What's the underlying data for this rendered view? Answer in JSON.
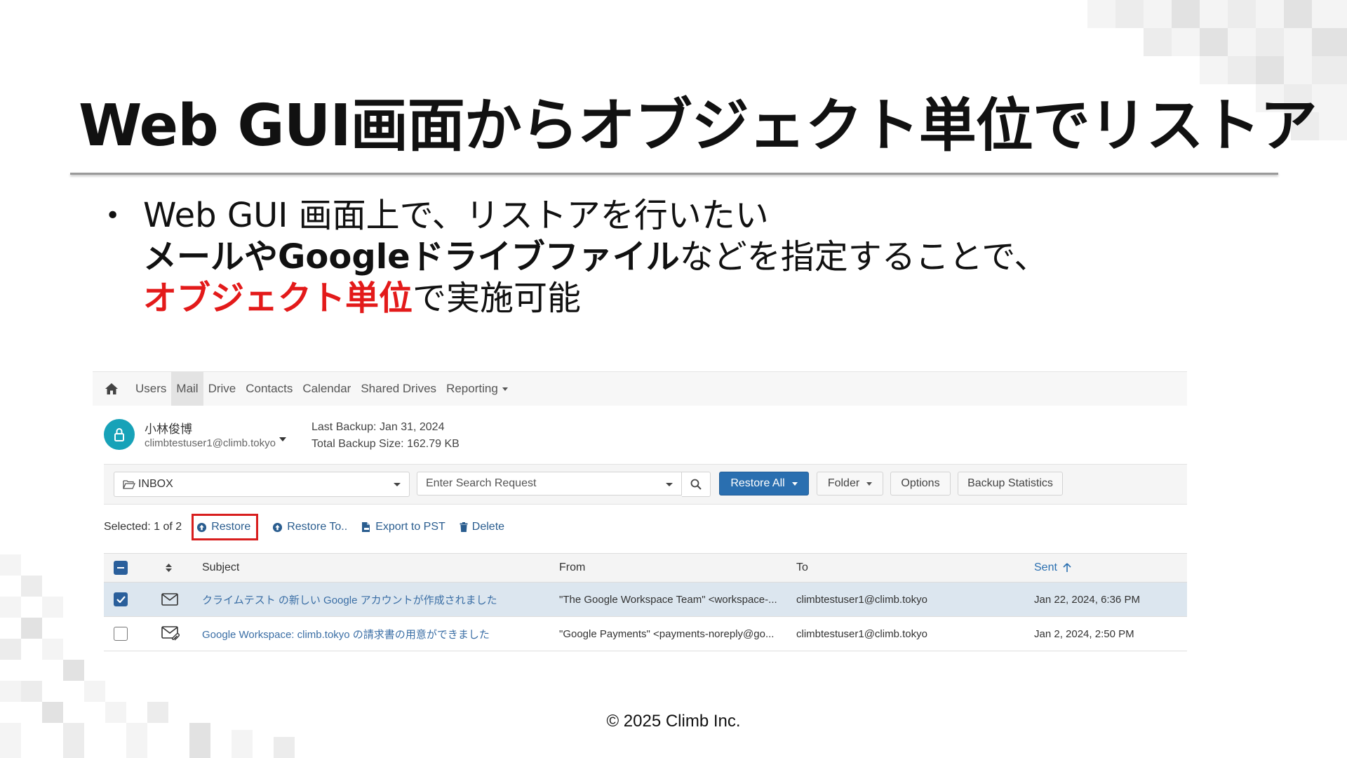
{
  "slide": {
    "title": "Web GUI画面からオブジェクト単位でリストア",
    "bullet_line1": "Web GUI 画面上で、リストアを行いたい",
    "bullet_line2_bold": "メールやGoogleドライブファイル",
    "bullet_line2_rest": "などを指定することで、",
    "bullet_line3_red": "オブジェクト単位",
    "bullet_line3_rest": "で実施可能",
    "footer": "© 2025 Climb Inc."
  },
  "nav": {
    "items": [
      "Users",
      "Mail",
      "Drive",
      "Contacts",
      "Calendar",
      "Shared Drives",
      "Reporting"
    ],
    "active": "Mail"
  },
  "user": {
    "name": "小林俊博",
    "email": "climbtestuser1@climb.tokyo",
    "last_backup": "Last Backup: Jan 31, 2024",
    "total_size": "Total Backup Size: 162.79 KB"
  },
  "toolbar": {
    "folder": "INBOX",
    "search_placeholder": "Enter Search Request",
    "restore_all": "Restore All",
    "folder_btn": "Folder",
    "options": "Options",
    "backup_stats": "Backup Statistics"
  },
  "actions": {
    "selected": "Selected: 1 of 2",
    "restore": "Restore",
    "restore_to": "Restore To..",
    "export_pst": "Export to PST",
    "delete": "Delete"
  },
  "table": {
    "headers": {
      "subject": "Subject",
      "from": "From",
      "to": "To",
      "sent": "Sent"
    },
    "rows": [
      {
        "selected": true,
        "subject": "クライムテスト の新しい Google アカウントが作成されました",
        "from": "\"The Google Workspace Team\" <workspace-...",
        "to": "climbtestuser1@climb.tokyo",
        "sent": "Jan 22, 2024, 6:36 PM"
      },
      {
        "selected": false,
        "subject": "Google Workspace: climb.tokyo の請求書の用意ができました",
        "from": "\"Google Payments\" <payments-noreply@go...",
        "to": "climbtestuser1@climb.tokyo",
        "sent": "Jan 2, 2024, 2:50 PM"
      }
    ]
  },
  "colors": {
    "accent_red": "#e31a1a",
    "primary_blue": "#2a6fb0",
    "selected_row": "#dce6ef",
    "avatar": "#17a2b8"
  }
}
